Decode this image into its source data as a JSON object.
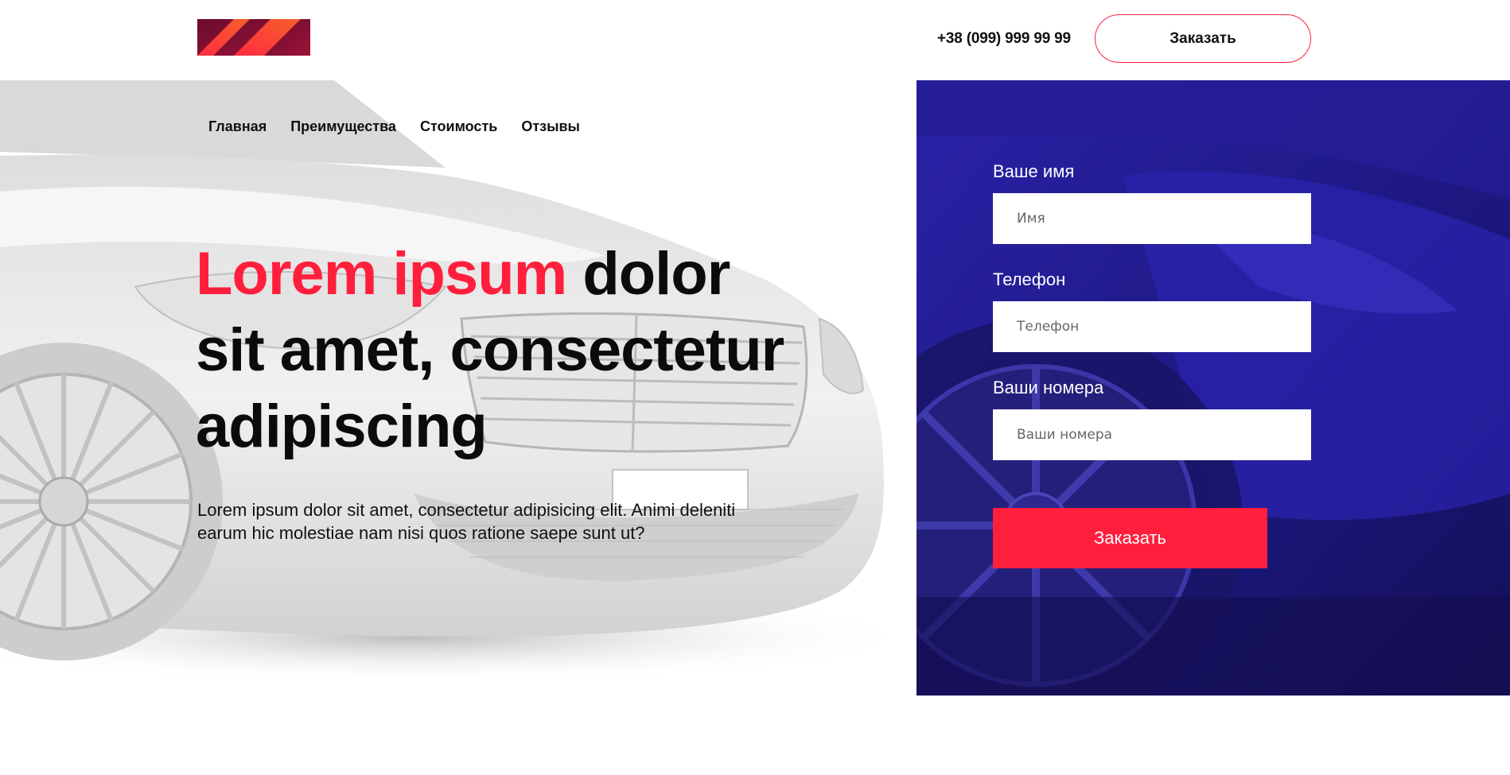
{
  "header": {
    "logo_name": "brand-logo",
    "phone": "+38 (099) 999 99 99",
    "order_button": "Заказать"
  },
  "nav": {
    "items": [
      {
        "label": "Главная"
      },
      {
        "label": "Преимущества"
      },
      {
        "label": "Стоимость"
      },
      {
        "label": "Отзывы"
      }
    ]
  },
  "hero": {
    "headline_accent": "Lorem ipsum",
    "headline_rest_1": " dolor",
    "headline_line_2": "sit amet, consectetur",
    "headline_line_3": "adipiscing",
    "lead": "Lorem ipsum dolor sit amet, consectetur adipisicing elit. Animi deleniti earum hic molestiae nam nisi quos ratione saepe sunt ut?"
  },
  "form": {
    "name_label": "Ваше имя",
    "name_placeholder": "Имя",
    "name_value": "",
    "phone_label": "Телефон",
    "phone_placeholder": "Телефон",
    "phone_value": "",
    "numbers_label": "Ваши номера",
    "numbers_placeholder": "Ваши номера",
    "numbers_value": "",
    "submit_label": "Заказать"
  },
  "colors": {
    "accent": "#ff1f3d",
    "panel": "#1c1770",
    "logo_dark": "#8a0f35",
    "logo_orange": "#f04a2a"
  }
}
